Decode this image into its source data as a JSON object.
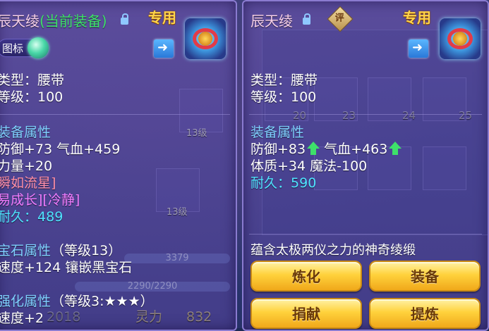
{
  "left": {
    "title": "辰天绫",
    "title_tag": "(当前装备)",
    "exclusive": "专用",
    "tag_button": "图标",
    "type": "类型：腰带",
    "level": "等级：100",
    "section_equip": "装备属性",
    "attr1": "防御+73 气血+459",
    "attr2": "力量+20",
    "special1": "瞬如流星]",
    "special2": "易成长][冷静]",
    "durability_label": "耐久：",
    "durability_value": "489",
    "section_gem": "宝石属性",
    "gem_level": "（等级13）",
    "gem_attr": "速度+124 镶嵌黑宝石",
    "section_strengthen": "强化属性",
    "strengthen_level": "（等级3:★★★）",
    "strengthen_attr": "速度+2"
  },
  "right": {
    "title": "辰天绫",
    "rate_badge": "评",
    "exclusive": "专用",
    "type": "类型：腰带",
    "level": "等级：100",
    "section_equip": "装备属性",
    "attr1a": "防御+83",
    "attr1b": "气血+463",
    "attr2": "体质+34 魔法-100",
    "durability_label": "耐久：",
    "durability_value": "590",
    "description": "蕴含太极两仪之力的神奇绫缎",
    "buttons": [
      "炼化",
      "装备",
      "捐献",
      "提炼"
    ]
  },
  "background": {
    "slot_labels": [
      "13级",
      "13级"
    ],
    "grid_numbers": [
      "20",
      "23",
      "24",
      "25"
    ],
    "bar1": "3379",
    "bar2": "2290/2290",
    "stat_label": "灵力",
    "stat_value": "832",
    "year": "2018"
  },
  "colors": {
    "accent_gold": "#ffd44a",
    "attr_section": "#7fd0ff",
    "durability": "#4fe3ff",
    "increase_arrow": "#3ee06a"
  }
}
